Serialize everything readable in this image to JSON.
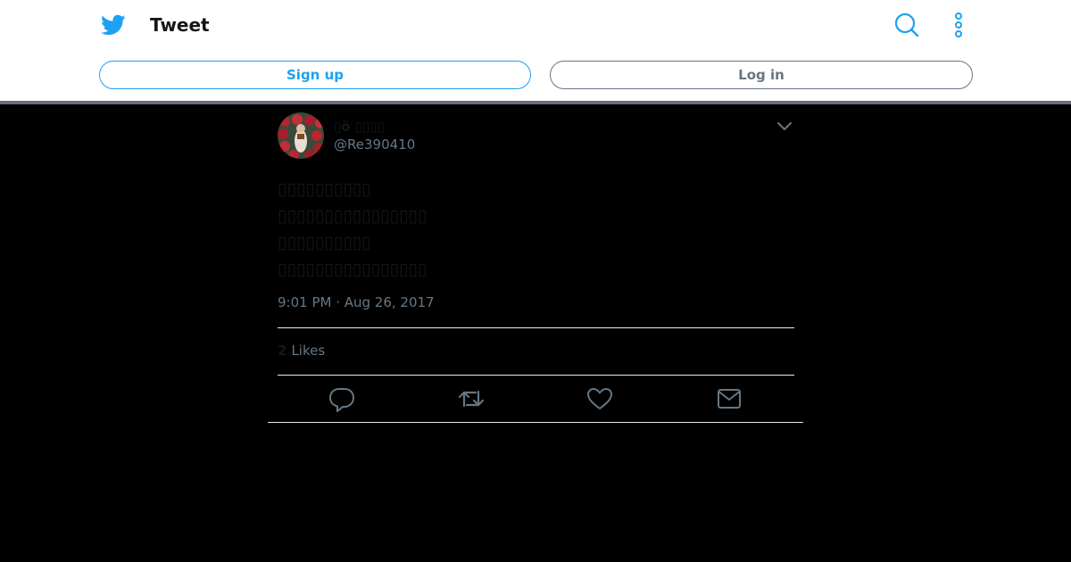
{
  "header": {
    "title": "Tweet",
    "signup_label": "Sign up",
    "login_label": "Log in",
    "logo_icon": "twitter-bird-icon",
    "search_icon": "search-icon",
    "more_icon": "more-vertical-icon",
    "brand_color": "#1da1f2"
  },
  "tweet": {
    "display_name": "▯ö ▯▯▯▯",
    "handle": "@Re390410",
    "lines": [
      "▯▯▯▯▯▯▯▯▯▯",
      "▯▯▯▯▯▯▯▯▯▯▯▯▯▯▯▯",
      "▯▯▯▯▯▯▯▯▯▯",
      "▯▯▯▯▯▯▯▯▯▯▯▯▯▯▯▯"
    ],
    "timestamp": "9:01 PM · Aug 26, 2017",
    "likes_count": "2",
    "likes_label": "Likes"
  },
  "actions": [
    "reply-icon",
    "retweet-icon",
    "like-icon",
    "share-mail-icon"
  ]
}
